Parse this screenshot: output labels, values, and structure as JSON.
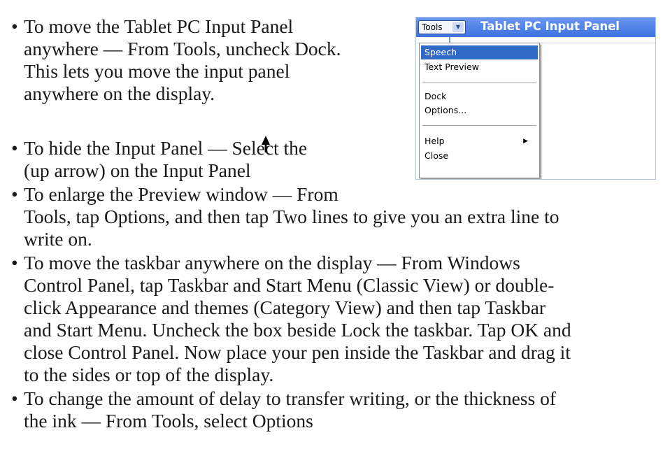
{
  "bullet_char": "•",
  "bullets": [
    {
      "lines": [
        "To move the Tablet PC Input Panel",
        "anywhere — From Tools, uncheck Dock.",
        "This lets you move the input panel",
        "anywhere on the display."
      ]
    },
    {
      "lines": [
        "To hide the Input Panel — Select the",
        "(up arrow) on the Input Panel"
      ]
    },
    {
      "lines": [
        "To enlarge the Preview window — From",
        "Tools, tap Options, and then tap Two lines to give you an extra line to",
        "write on."
      ]
    },
    {
      "lines": [
        "To move the taskbar anywhere on the display — From Windows",
        "Control Panel, tap Taskbar and Start Menu (Classic View) or double-",
        "click Appearance and themes (Category View) and then tap Taskbar",
        "and Start Menu. Uncheck the box beside Lock the taskbar. Tap OK and",
        "close Control Panel. Now place your pen inside the Taskbar and drag it",
        "to the sides or top of the display."
      ]
    },
    {
      "lines": [
        "To change the amount of delay to transfer writing, or the thickness of",
        "the ink — From Tools, select Options"
      ]
    }
  ],
  "screenshot": {
    "tools_label": "Tools",
    "title": "Tablet PC Input Panel",
    "menu": [
      "Speech",
      "Text Preview",
      "Dock",
      "Options...",
      "Help",
      "Close"
    ],
    "titlebar_color": "#4a7fe6",
    "selected_color": "#316ac5"
  }
}
